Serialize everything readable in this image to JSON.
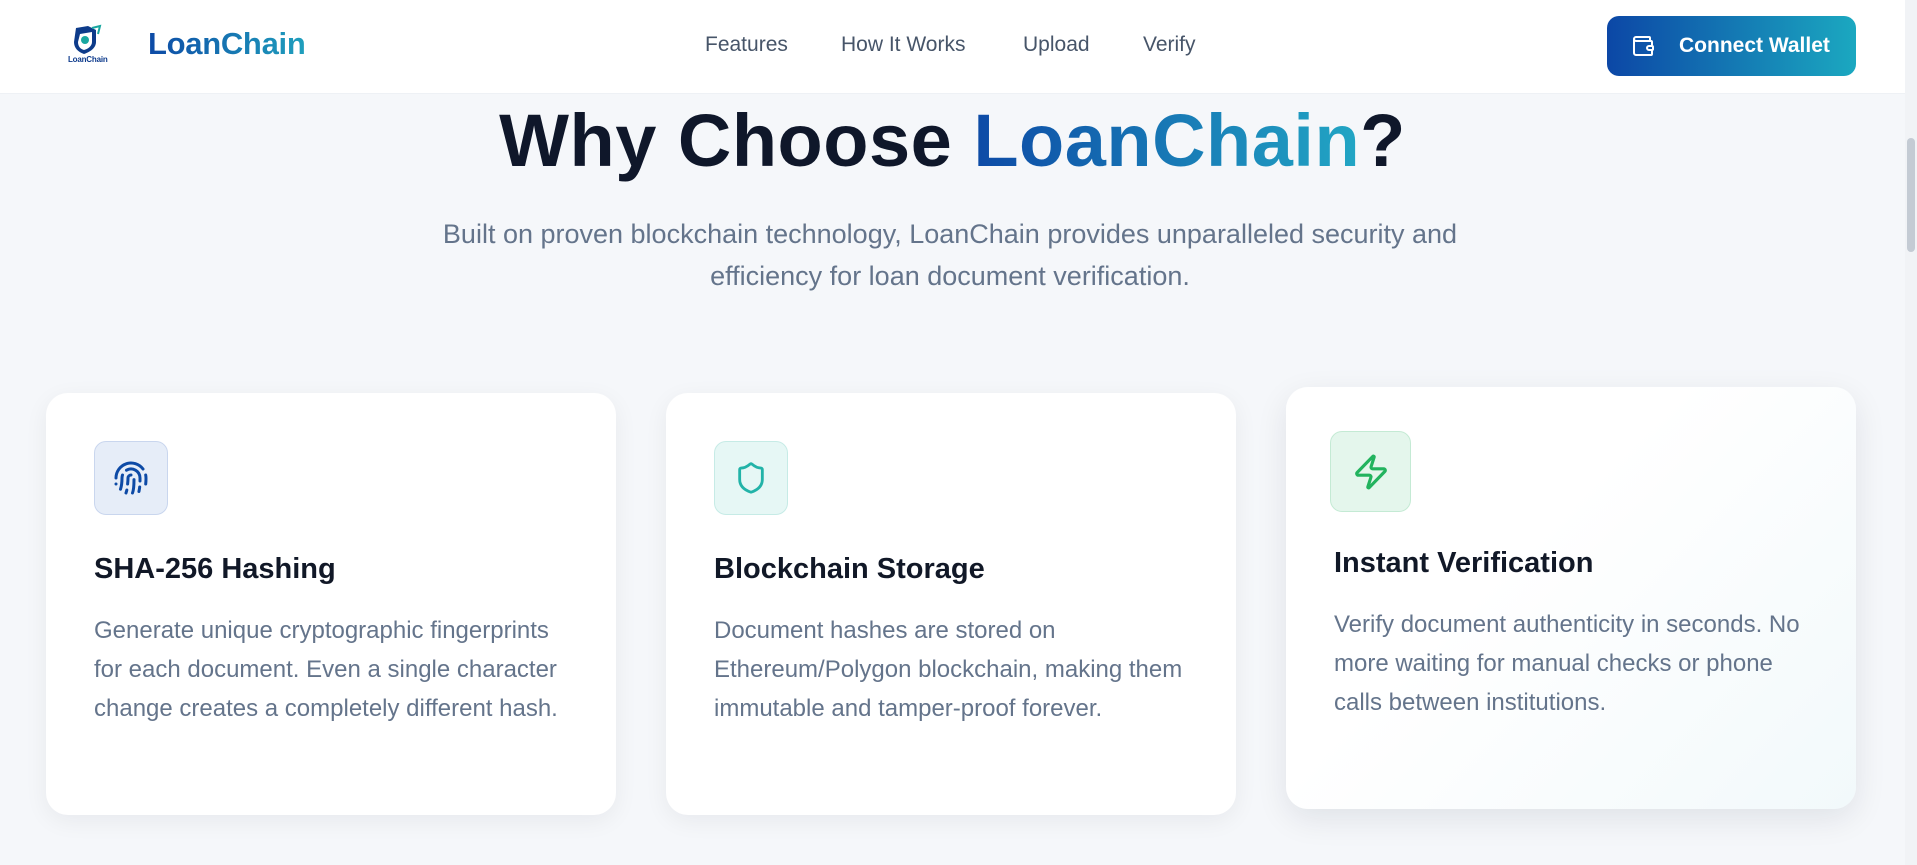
{
  "header": {
    "logo_text": "LoanChain",
    "brand": "LoanChain",
    "nav": [
      "Features",
      "How It Works",
      "Upload",
      "Verify"
    ],
    "connect_wallet": "Connect Wallet"
  },
  "hero": {
    "title_prefix": "Why Choose ",
    "title_accent": "LoanChain",
    "title_suffix": "?",
    "subtitle": "Built on proven blockchain technology, LoanChain provides unparalleled security and efficiency for loan document verification."
  },
  "features": [
    {
      "icon": "fingerprint-icon",
      "title": "SHA-256 Hashing",
      "text": "Generate unique cryptographic fingerprints for each document. Even a single character change creates a completely different hash."
    },
    {
      "icon": "shield-icon",
      "title": "Blockchain Storage",
      "text": "Document hashes are stored on Ethereum/Polygon blockchain, making them immutable and tamper-proof forever."
    },
    {
      "icon": "lightning-icon",
      "title": "Instant Verification",
      "text": "Verify document authenticity in seconds. No more waiting for manual checks or phone calls between institutions."
    }
  ],
  "colors": {
    "brand_blue": "#0d4aa6",
    "brand_teal": "#1f9fbd",
    "text_muted": "#64748b",
    "heading": "#0f172a"
  }
}
